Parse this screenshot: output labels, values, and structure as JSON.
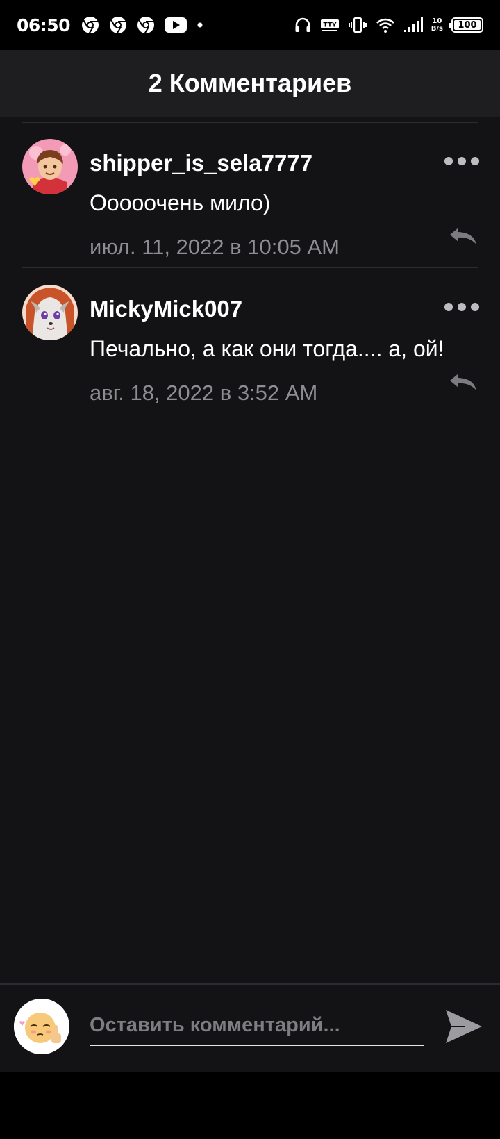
{
  "status_bar": {
    "time": "06:50",
    "left_icons": [
      "chrome-icon",
      "chrome-icon",
      "chrome-icon",
      "youtube-icon",
      "dot-icon"
    ],
    "right_icons": [
      "headphones-icon",
      "tty-icon",
      "vibrate-icon",
      "wifi-icon",
      "signal-icon"
    ],
    "tty_label": "TTY",
    "speed_value": "10",
    "speed_unit": "B/s",
    "battery_level": "100",
    "battery_fraction": 1.0
  },
  "header": {
    "title": "2 Комментариев"
  },
  "comments": [
    {
      "username": "shipper_is_sela7777",
      "text": "Ооооочень мило)",
      "time": "июл. 11, 2022 в 10:05 AM",
      "avatar_icon": "user-avatar"
    },
    {
      "username": "MickyMick007",
      "text": "Печально, а как они тогда.... а, ой!",
      "time": "авг. 18, 2022 в 3:52 AM",
      "avatar_icon": "user-avatar"
    }
  ],
  "composer": {
    "placeholder": "Оставить комментарий...",
    "value": ""
  },
  "colors": {
    "background": "#131215",
    "header_bg": "#1e1d20",
    "muted_text": "#8e8d92",
    "divider": "#2c2b2f"
  }
}
